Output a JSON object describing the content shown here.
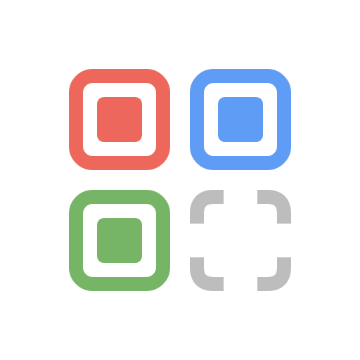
{
  "icon": {
    "name": "color-grid-app-icon",
    "tiles": [
      {
        "name": "red-tile",
        "color": "#ee675c",
        "state": "filled"
      },
      {
        "name": "blue-tile",
        "color": "#5f9cf5",
        "state": "filled"
      },
      {
        "name": "green-tile",
        "color": "#77b566",
        "state": "filled"
      },
      {
        "name": "empty-tile",
        "color": "#bdbdbd",
        "state": "empty"
      }
    ]
  }
}
